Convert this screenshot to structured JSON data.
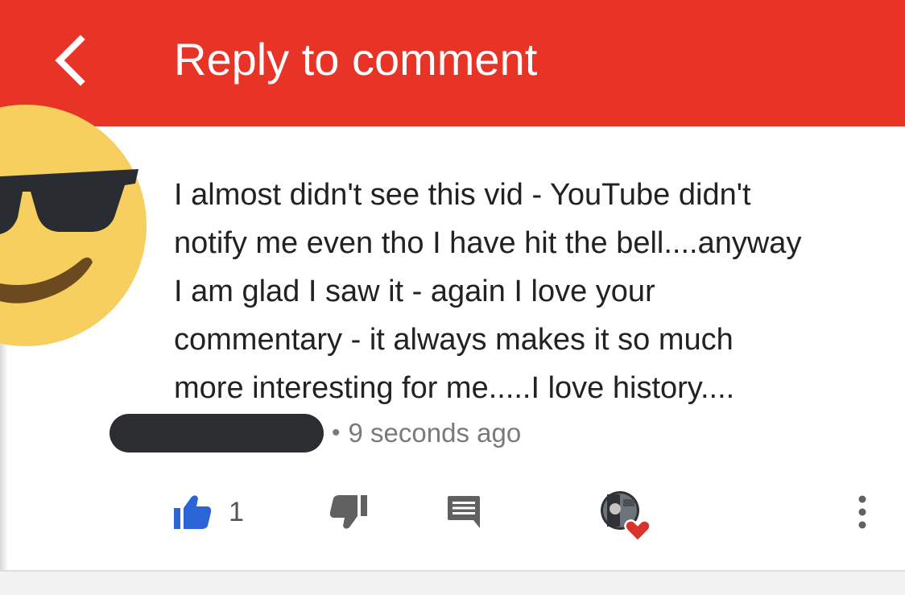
{
  "header": {
    "title": "Reply to comment",
    "back_icon": "chevron-left-icon",
    "background_color": "#e83427"
  },
  "comment": {
    "avatar_icon": "sunglasses-smiley-icon",
    "lines": [
      "I almost didn't see this vid - YouTube didn't",
      "notify me even tho I have hit the bell....anyway",
      "I am glad I saw it - again I love your",
      "commentary - it always makes it so much",
      "more interesting for me.....I love history...."
    ],
    "separator": "•",
    "timestamp": "9 seconds ago"
  },
  "actions": {
    "like_icon": "thumbs-up-icon",
    "like_count": "1",
    "like_color": "#2a64d6",
    "dislike_icon": "thumbs-down-icon",
    "reply_icon": "comment-icon",
    "creator_heart_icon": "creator-heart-icon",
    "heart_color": "#d9342b",
    "more_icon": "more-vertical-icon"
  }
}
